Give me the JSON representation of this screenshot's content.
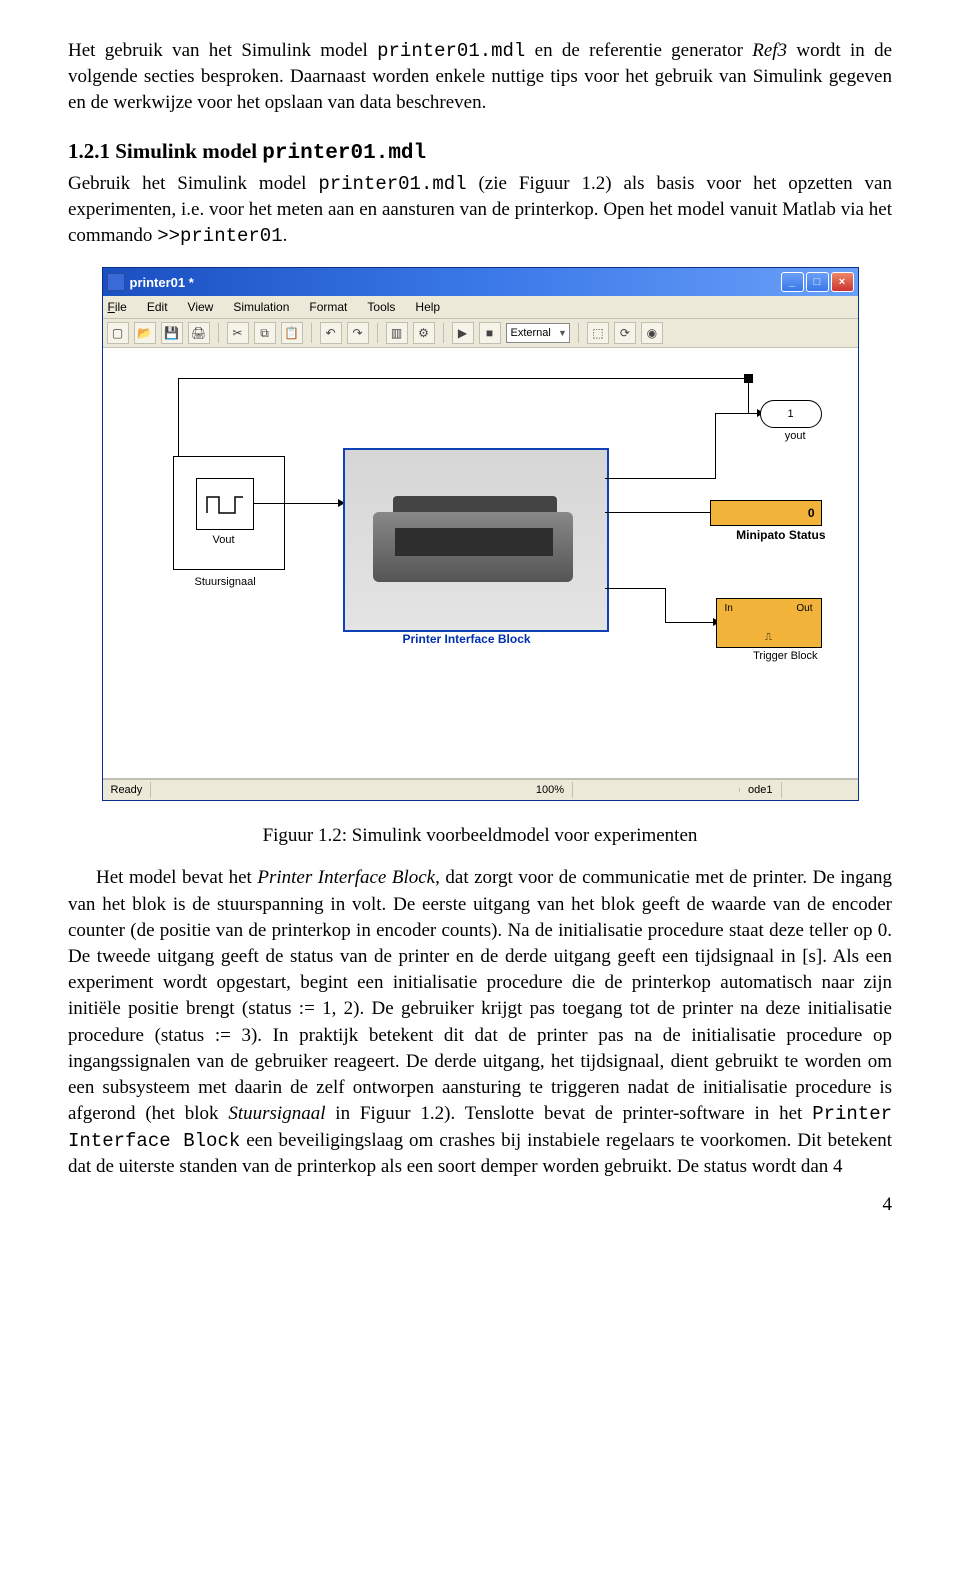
{
  "para1_a": "Het gebruik van het Simulink model ",
  "para1_b": " en de referentie generator ",
  "para1_c": " wordt in de volgende secties besproken. Daarnaast worden enkele nuttige tips voor het gebruik van Simulink gegeven en de werkwijze voor het opslaan van data beschreven.",
  "mono_printer_mdl": "printer01.mdl",
  "italic_ref3": "Ref3",
  "sec_heading_num": "1.2.1 Simulink model ",
  "sec_heading_mono": "printer01.mdl",
  "para2_a": "Gebruik het Simulink model ",
  "para2_b": " (zie Figuur 1.2) als basis voor het opzetten van experimenten, i.e. voor het meten aan en aansturen van de printerkop. Open het model vanuit Matlab via het commando ",
  "para2_c": ".",
  "mono_cmd": ">>printer01",
  "caption": "Figuur 1.2: Simulink voorbeeldmodel voor experimenten",
  "para3_a": "Het model bevat het ",
  "para3_b": ", dat zorgt voor de communicatie met de printer. De ingang van het blok is de stuurspanning in volt. De eerste uitgang van het blok geeft de waarde van de encoder counter (de positie van de printerkop in encoder counts). Na de initialisatie procedure staat deze teller op 0. De tweede uitgang geeft de status van de printer en de derde uitgang geeft een tijdsignaal in [s]. Als een experiment wordt opgestart, begint een initialisatie procedure die de printerkop automatisch naar zijn initiële positie brengt (status := 1, 2). De gebruiker krijgt pas toegang tot de printer na deze initialisatie procedure (status := 3). In praktijk betekent dit dat de printer pas na de initialisatie procedure op ingangssignalen van de gebruiker reageert. De derde uitgang, het tijdsignaal, dient gebruikt te worden om een subsysteem met daarin de zelf ontworpen aansturing te triggeren nadat de initialisatie procedure is afgerond (het blok ",
  "para3_c": " in Figuur 1.2). Tenslotte bevat de printer-software in het ",
  "para3_d": " een beveiligingslaag om crashes bij instabiele regelaars te voorkomen. Dit betekent dat de uiterste standen van de printerkop als een soort demper worden gebruikt. De status wordt dan 4",
  "italic_pib": "Printer Interface Block",
  "italic_stuur": "Stuursignaal",
  "mono_pib": "Printer Interface Block",
  "page_num": "4",
  "sim": {
    "title": "printer01 *",
    "menu": {
      "file": "File",
      "edit": "Edit",
      "view": "View",
      "simulation": "Simulation",
      "format": "Format",
      "tools": "Tools",
      "help": "Help"
    },
    "toolbar": {
      "normal": "External"
    },
    "blocks": {
      "vout": "Vout",
      "stuur": "Stuursignaal",
      "pib": "Printer Interface Block",
      "yout_num": "1",
      "yout_lbl": "yout",
      "mini_num": "0",
      "mini_lbl": "Minipato Status",
      "trig_in": "In",
      "trig_out": "Out",
      "trig_lbl": "Trigger Block"
    },
    "status": {
      "ready": "Ready",
      "zoom": "100%",
      "solver": "ode1"
    }
  }
}
